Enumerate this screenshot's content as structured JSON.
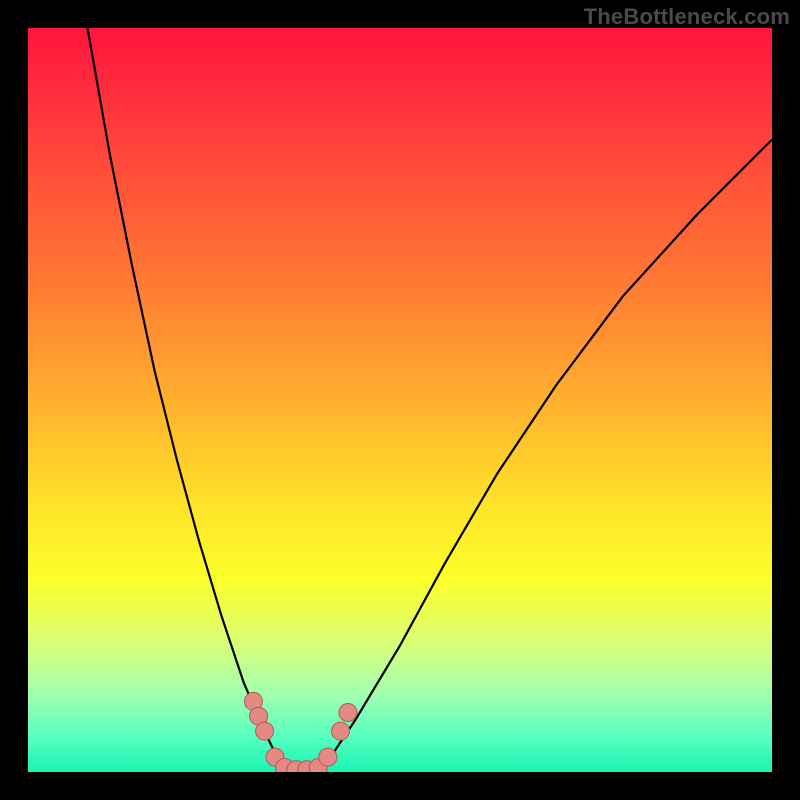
{
  "watermark": {
    "text": "TheBottleneck.com"
  },
  "colors": {
    "curve": "#000000",
    "marker_fill": "#e38a84",
    "marker_stroke": "#af5a54",
    "gradient_top": "#ff143f",
    "gradient_bottom": "#19f5b2",
    "frame": "#000000"
  },
  "chart_data": {
    "type": "line",
    "title": "",
    "xlabel": "",
    "ylabel": "",
    "xlim": [
      0,
      1
    ],
    "ylim": [
      0,
      1
    ],
    "grid": false,
    "legend": false,
    "series": [
      {
        "name": "left-curve",
        "x": [
          0.08,
          0.11,
          0.14,
          0.17,
          0.2,
          0.23,
          0.26,
          0.29,
          0.32,
          0.34
        ],
        "y": [
          1.0,
          0.83,
          0.68,
          0.54,
          0.42,
          0.31,
          0.21,
          0.12,
          0.05,
          0.01
        ]
      },
      {
        "name": "right-curve",
        "x": [
          0.4,
          0.44,
          0.5,
          0.56,
          0.63,
          0.71,
          0.8,
          0.9,
          1.0
        ],
        "y": [
          0.01,
          0.07,
          0.17,
          0.28,
          0.4,
          0.52,
          0.64,
          0.75,
          0.85
        ]
      },
      {
        "name": "valley-floor",
        "x": [
          0.34,
          0.36,
          0.38,
          0.4
        ],
        "y": [
          0.01,
          0.003,
          0.003,
          0.01
        ]
      }
    ],
    "markers": {
      "name": "highlighted-points",
      "points": [
        {
          "x": 0.303,
          "y": 0.095
        },
        {
          "x": 0.31,
          "y": 0.075
        },
        {
          "x": 0.318,
          "y": 0.055
        },
        {
          "x": 0.332,
          "y": 0.02
        },
        {
          "x": 0.345,
          "y": 0.006
        },
        {
          "x": 0.36,
          "y": 0.003
        },
        {
          "x": 0.375,
          "y": 0.003
        },
        {
          "x": 0.39,
          "y": 0.006
        },
        {
          "x": 0.403,
          "y": 0.02
        },
        {
          "x": 0.42,
          "y": 0.055
        },
        {
          "x": 0.43,
          "y": 0.08
        }
      ]
    }
  }
}
